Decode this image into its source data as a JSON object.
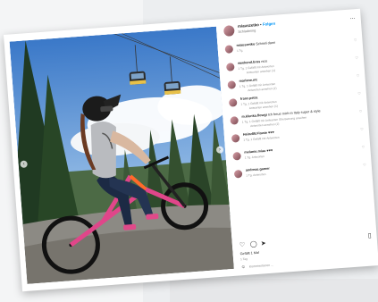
{
  "post": {
    "username": "miauszetko",
    "follow_label": "Folgen",
    "location": "Schladming",
    "menu_icon": "more-dots-icon"
  },
  "comments": [
    {
      "user": "miauszetko",
      "text": "Schneli dann",
      "meta": "1 Tg.",
      "replies": ""
    },
    {
      "user": "weekend.bros",
      "text": "nice",
      "meta": "1 Tg.  1 Gefällt mir  Antworten",
      "replies": "Antworten ansehen (1)"
    },
    {
      "user": "marlene.mt",
      "text": "",
      "meta": "1 Tg.  1 Gefällt mir  Antworten",
      "replies": "Antworten ansehen (1)"
    },
    {
      "user": "franz.petra",
      "text": "",
      "meta": "1 Tg.  1 Gefällt mir  Antworten",
      "replies": "Antworten ansehen (1)"
    },
    {
      "user": "m.klunka.flowgi",
      "text": "Ich freue mich in Italy super & style",
      "meta": "1 Tg.  1 Gefällt mir  Antworten  Übersetzung ansehen",
      "replies": "Antworten ansehen (1)"
    },
    {
      "user": "Heinz89.Flowie",
      "text": "♥♥♥",
      "meta": "1 Tg.  1 Gefällt mir  Antworten",
      "replies": ""
    },
    {
      "user": "melanie.miau",
      "text": "♥♥♥",
      "meta": "1 Tg.  Antworten",
      "replies": ""
    },
    {
      "user": "andreas.gamer",
      "text": "",
      "meta": "1 Tg.  Antworten",
      "replies": ""
    }
  ],
  "icons": {
    "like": "heart-icon",
    "comment": "comment-icon",
    "share": "share-icon",
    "save": "bookmark-icon"
  },
  "likes_text": "Gefällt 1 Mal",
  "date_text": "1 Tag",
  "add_comment_placeholder": "Kommentieren ..."
}
